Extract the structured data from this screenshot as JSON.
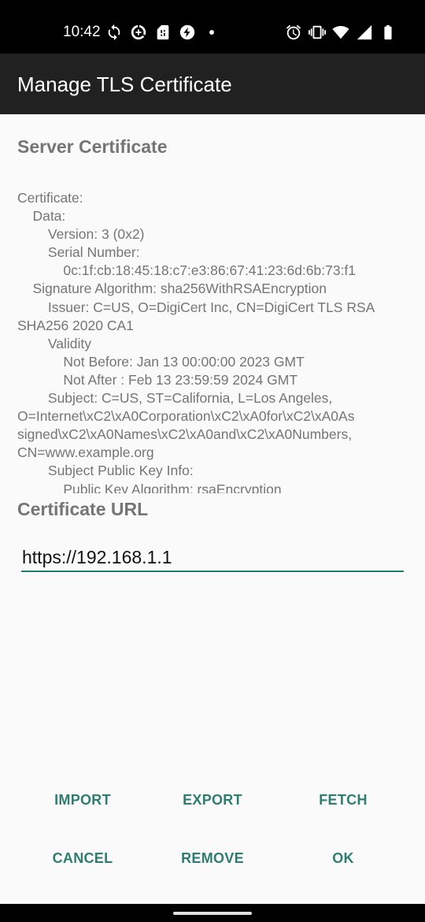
{
  "status_bar": {
    "time": "10:42",
    "left_icons": [
      "sync-icon",
      "data-saver-icon",
      "sim-card-icon",
      "bolt-icon",
      "dot-icon"
    ],
    "right_icons": [
      "alarm-icon",
      "vibrate-icon",
      "wifi-icon",
      "signal-icon",
      "battery-icon"
    ]
  },
  "app_bar": {
    "title": "Manage TLS Certificate"
  },
  "server_certificate": {
    "title": "Server Certificate",
    "lines": [
      "Certificate:",
      "    Data:",
      "        Version: 3 (0x2)",
      "        Serial Number:",
      "            0c:1f:cb:18:45:18:c7:e3:86:67:41:23:6d:6b:73:f1",
      "    Signature Algorithm: sha256WithRSAEncryption",
      "        Issuer: C=US, O=DigiCert Inc, CN=DigiCert TLS RSA",
      "SHA256 2020 CA1",
      "        Validity",
      "            Not Before: Jan 13 00:00:00 2023 GMT",
      "            Not After : Feb 13 23:59:59 2024 GMT",
      "        Subject: C=US, ST=California, L=Los Angeles,",
      "O=Internet\\xC2\\xA0Corporation\\xC2\\xA0for\\xC2\\xA0As",
      "signed\\xC2\\xA0Names\\xC2\\xA0and\\xC2\\xA0Numbers,",
      "CN=www.example.org",
      "        Subject Public Key Info:",
      "            Public Key Algorithm: rsaEncryption"
    ]
  },
  "certificate_url": {
    "title": "Certificate URL",
    "value": "https://192.168.1.1"
  },
  "buttons": {
    "import": "IMPORT",
    "export": "EXPORT",
    "fetch": "FETCH",
    "cancel": "CANCEL",
    "remove": "REMOVE",
    "ok": "OK"
  },
  "colors": {
    "accent": "#2e7d70",
    "app_bar": "#212121",
    "text_secondary": "#757575"
  }
}
